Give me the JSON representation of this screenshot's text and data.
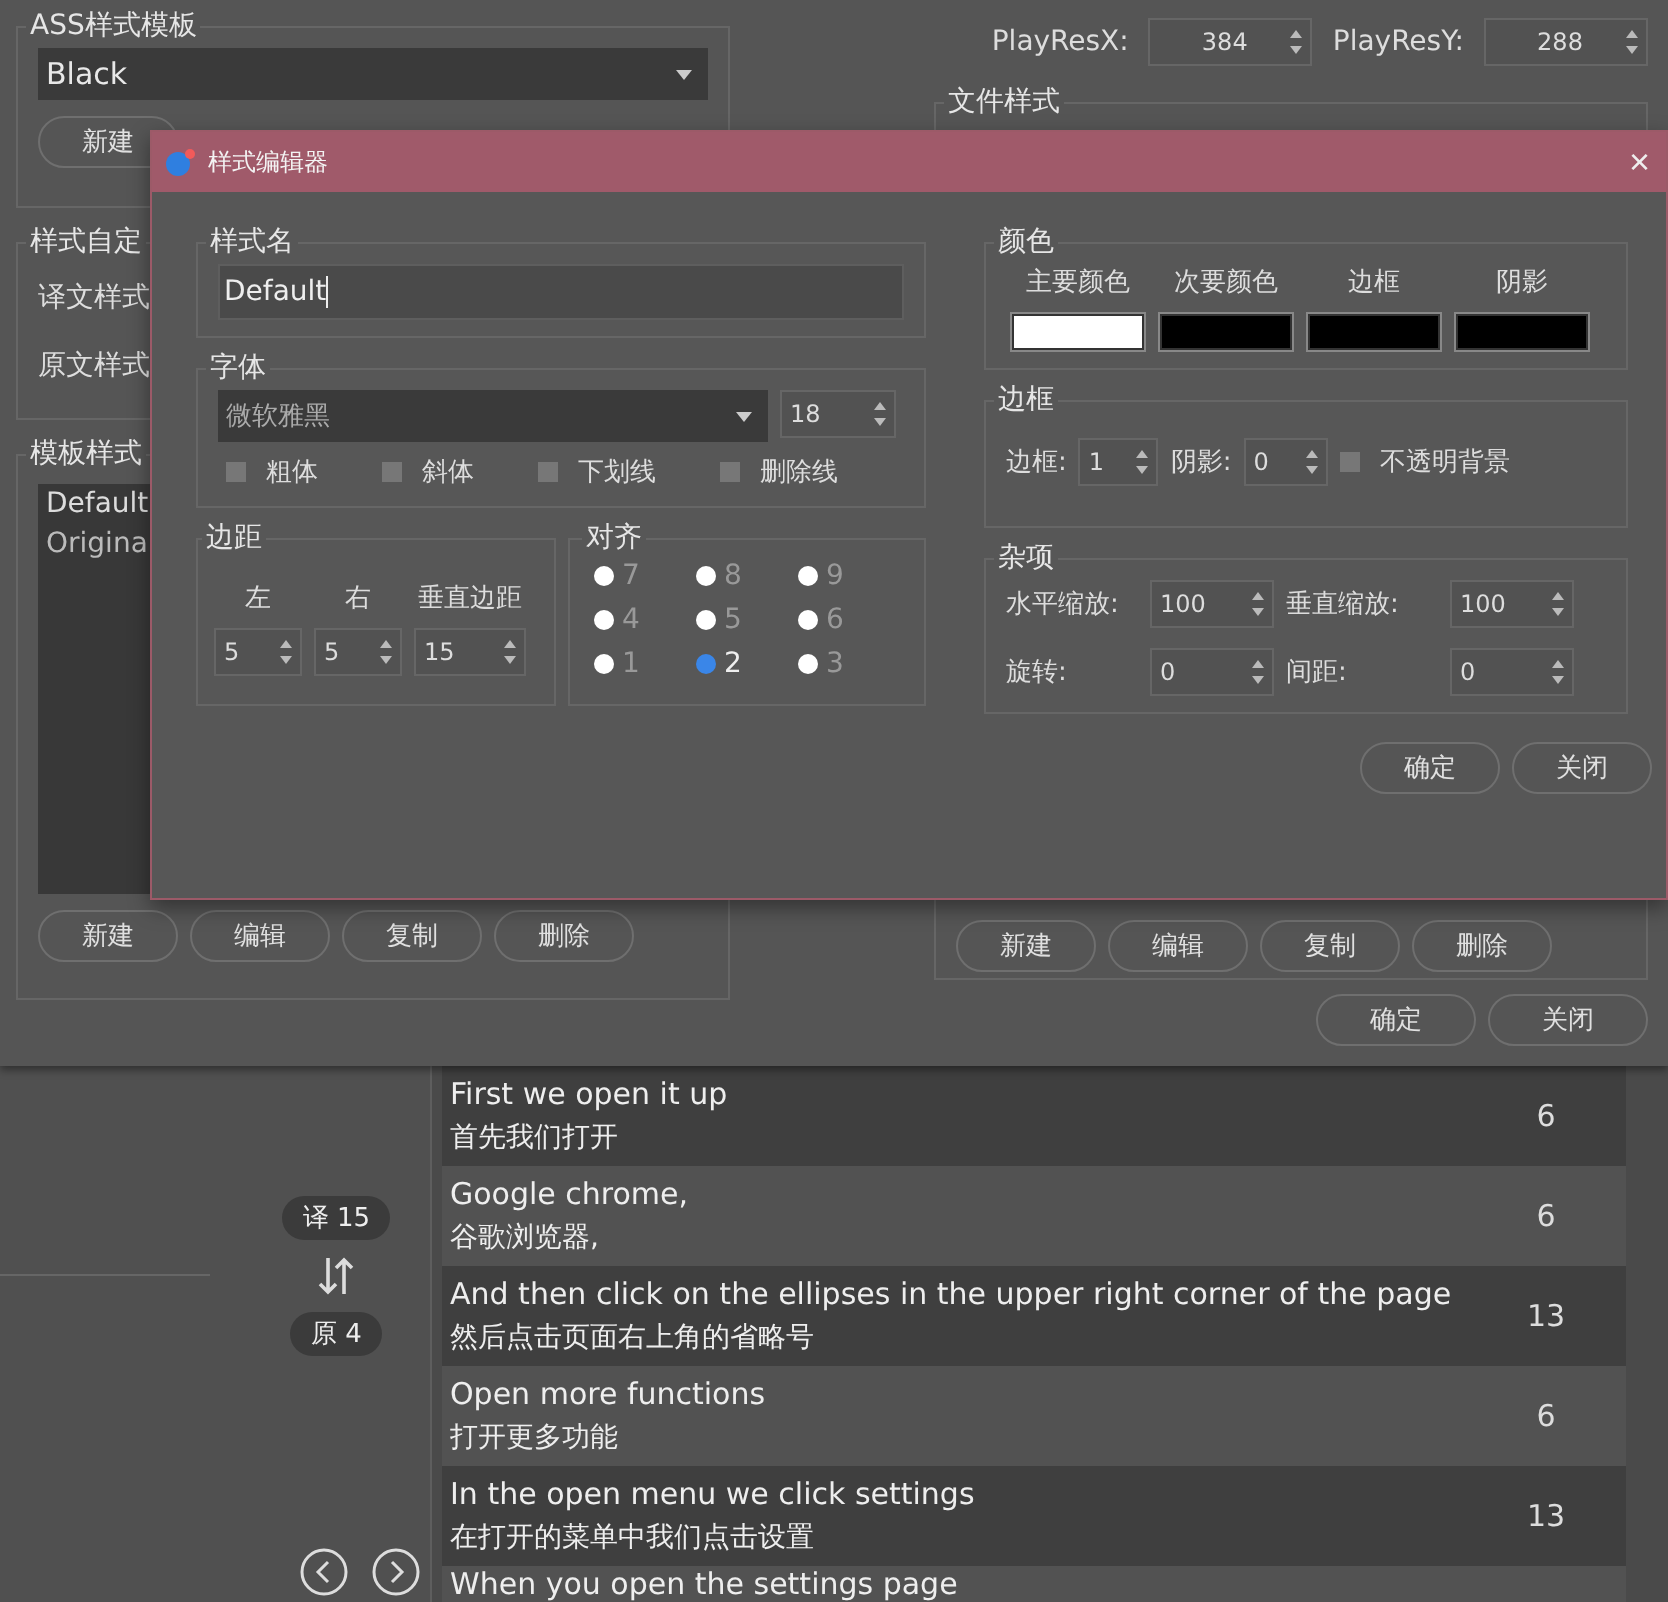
{
  "main_dialog": {
    "template_group": {
      "title": "ASS样式模板",
      "combo": "Black",
      "new_button": "新建"
    },
    "custom_group": {
      "title": "样式自定",
      "labels": [
        "译文样式",
        "原文样式"
      ]
    },
    "template_styles": {
      "title": "模板样式",
      "items": [
        "Default",
        "Origina"
      ],
      "buttons": [
        "新建",
        "编辑",
        "复制",
        "删除"
      ]
    },
    "play_res": [
      {
        "label": "PlayResX:",
        "value": "384"
      },
      {
        "label": "PlayResY:",
        "value": "288"
      }
    ],
    "file_styles": {
      "title": "文件样式",
      "buttons": [
        "新建",
        "编辑",
        "复制",
        "删除"
      ]
    },
    "buttons": [
      "确定",
      "关闭"
    ]
  },
  "style_editor": {
    "title": "样式编辑器",
    "close": "×",
    "name_group": {
      "title": "样式名",
      "value": "Default"
    },
    "font_group": {
      "title": "字体",
      "font": "微软雅黑",
      "size": "18",
      "options": [
        {
          "label": "粗体",
          "checked": false
        },
        {
          "label": "斜体",
          "checked": false
        },
        {
          "label": "下划线",
          "checked": false
        },
        {
          "label": "删除线",
          "checked": false
        }
      ]
    },
    "margin_group": {
      "title": "边距",
      "fields": [
        {
          "label": "左",
          "value": "5"
        },
        {
          "label": "右",
          "value": "5"
        },
        {
          "label": "垂直边距",
          "value": "15"
        }
      ]
    },
    "align_group": {
      "title": "对齐",
      "options": [
        {
          "label": "7",
          "selected": false
        },
        {
          "label": "8",
          "selected": false
        },
        {
          "label": "9",
          "selected": false
        },
        {
          "label": "4",
          "selected": false
        },
        {
          "label": "5",
          "selected": false
        },
        {
          "label": "6",
          "selected": false
        },
        {
          "label": "1",
          "selected": false
        },
        {
          "label": "2",
          "selected": true
        },
        {
          "label": "3",
          "selected": false
        }
      ]
    },
    "color_group": {
      "title": "颜色",
      "colors": [
        {
          "label": "主要颜色",
          "color": "#ffffff"
        },
        {
          "label": "次要颜色",
          "color": "#000000"
        },
        {
          "label": "边框",
          "color": "#000000"
        },
        {
          "label": "阴影",
          "color": "#000000"
        }
      ]
    },
    "border_group": {
      "title": "边框",
      "border_label": "边框:",
      "border_value": "1",
      "shadow_label": "阴影:",
      "shadow_value": "0",
      "opaque": {
        "label": "不透明背景",
        "checked": false
      }
    },
    "misc_group": {
      "title": "杂项",
      "fields": [
        {
          "label": "水平缩放:",
          "value": "100"
        },
        {
          "label": "垂直缩放:",
          "value": "100"
        },
        {
          "label": "旋转:",
          "value": "0"
        },
        {
          "label": "间距:",
          "value": "0"
        }
      ]
    },
    "buttons": [
      "确定",
      "关闭"
    ]
  },
  "subtitle_panel": {
    "translation_badge": "译 15",
    "original_badge": "原 4"
  },
  "subtitles": [
    {
      "text": "First we open it up",
      "translation": "首先我们打开",
      "count": "6"
    },
    {
      "text": "Google chrome,",
      "translation": "谷歌浏览器,",
      "count": "6"
    },
    {
      "text": "And then click on the ellipses in the upper right corner of the page",
      "translation": "然后点击页面右上角的省略号",
      "count": "13"
    },
    {
      "text": "Open more functions",
      "translation": "打开更多功能",
      "count": "6"
    },
    {
      "text": "In the open menu we click settings",
      "translation": "在打开的菜单中我们点击设置",
      "count": "13"
    },
    {
      "text": "When you open the settings page"
    }
  ]
}
